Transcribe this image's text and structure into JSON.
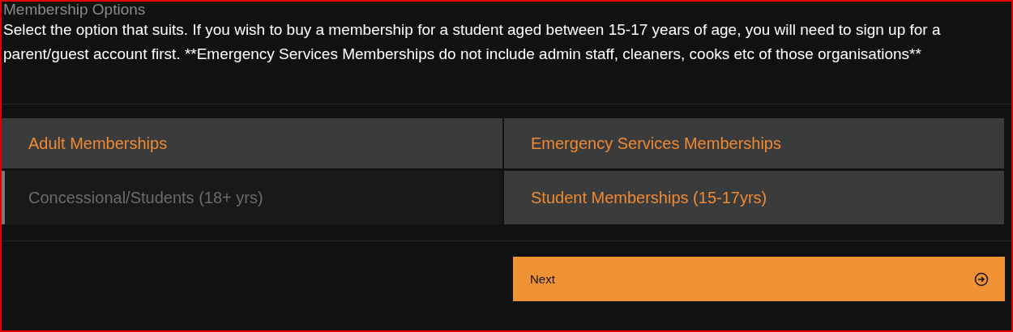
{
  "heading": "Membership Options",
  "description": "Select the option that suits. If you wish to buy a membership for a student aged between 15-17 years of age, you will need to sign up for a parent/guest account first. **Emergency Services Memberships do not include admin staff, cleaners, cooks etc of those organisations**",
  "options": [
    {
      "label": "Adult Memberships",
      "selected": false
    },
    {
      "label": "Emergency Services Memberships",
      "selected": false
    },
    {
      "label": "Concessional/Students (18+ yrs)",
      "selected": true
    },
    {
      "label": "Student Memberships (15-17yrs)",
      "selected": false
    }
  ],
  "next_button": {
    "label": "Next"
  }
}
